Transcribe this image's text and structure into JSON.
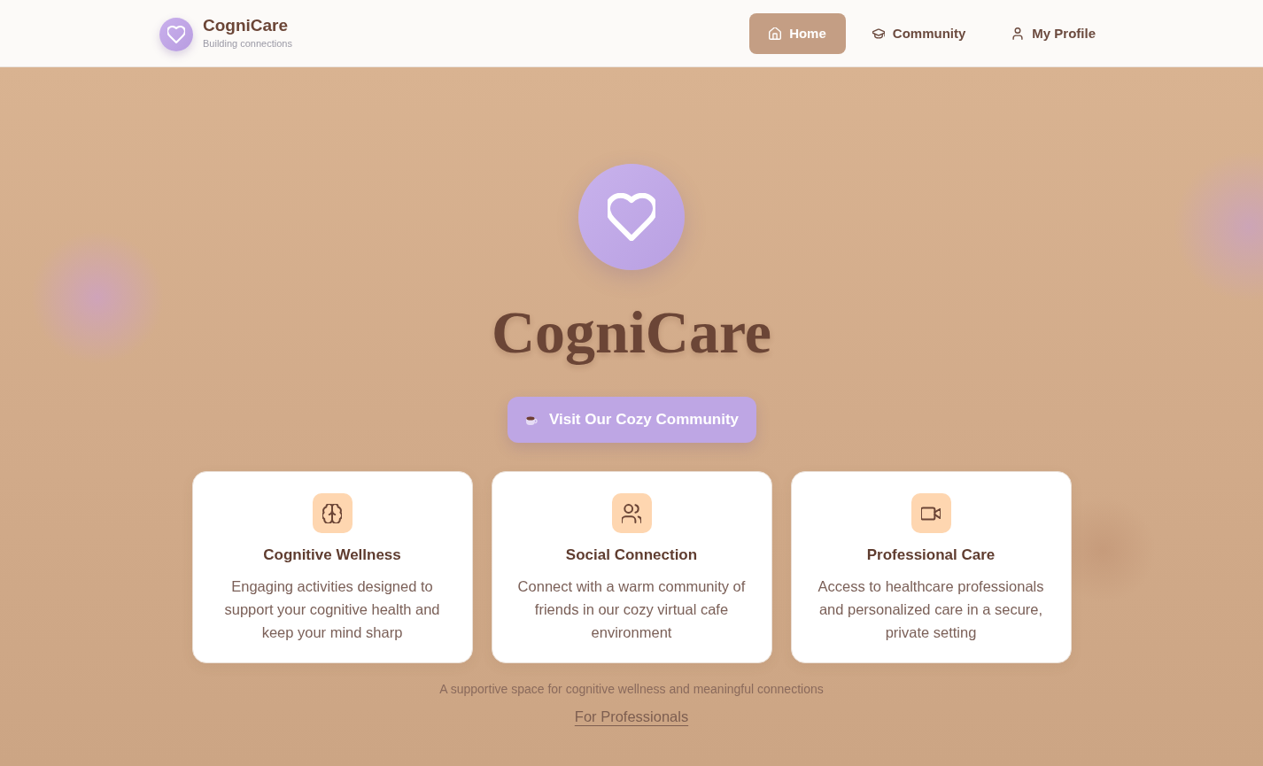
{
  "header": {
    "logo_title": "CogniCare",
    "logo_subtitle": "Building connections"
  },
  "nav": [
    {
      "label": "Home",
      "selected": true
    },
    {
      "label": "Community",
      "selected": false
    },
    {
      "label": "My Profile",
      "selected": false
    }
  ],
  "hero": {
    "title": "CogniCare",
    "cta": "Visit Our Cozy Community"
  },
  "features": [
    {
      "title": "Cognitive Wellness",
      "description": "Engaging activities designed to support your cognitive health and keep your mind sharp"
    },
    {
      "title": "Social Connection",
      "description": "Connect with a warm community of friends in our cozy virtual cafe environment"
    },
    {
      "title": "Professional Care",
      "description": "Access to healthcare professionals and personalized care in a secure, private setting"
    }
  ],
  "footer": {
    "tagline": "A supportive space for cognitive wellness and meaningful connections",
    "professionals_link": "For Professionals"
  }
}
